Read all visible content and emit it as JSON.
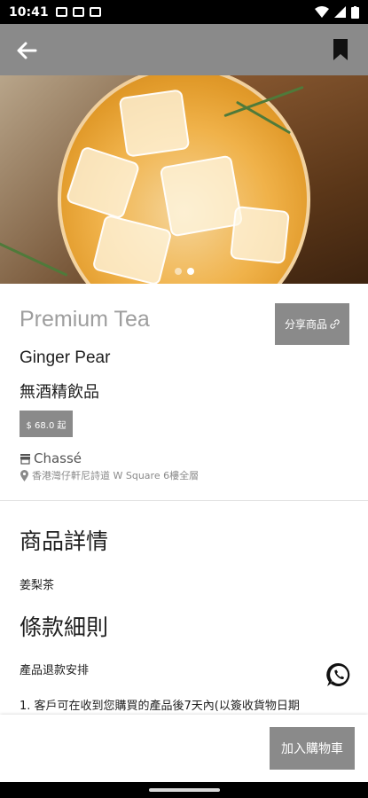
{
  "status_bar": {
    "time": "10:41"
  },
  "product": {
    "brand": "Premium Tea",
    "name": "Ginger Pear",
    "category": "無酒精飲品",
    "price": "$ 68.0 起",
    "shop_name": "Chassé",
    "address": "香港灣仔軒尼詩道 W Square 6樓全層",
    "share_label": "分享商品"
  },
  "details": {
    "title": "商品詳情",
    "text": "姜梨茶"
  },
  "terms": {
    "title": "條款細則",
    "subtitle": "產品退款安排",
    "item1": "1. 客戶可在收到您購買的產品後7天內(以簽收貨物日期"
  },
  "cart": {
    "label": "加入購物車"
  },
  "carousel": {
    "count": 2,
    "active": 1
  },
  "icons": [
    "back-arrow-icon",
    "bookmark-icon",
    "store-icon",
    "location-pin-icon",
    "link-icon",
    "whatsapp-icon"
  ],
  "colors": {
    "accent": "#8a8a8a",
    "text": "#1f1f1f",
    "muted": "#9e9e9e"
  }
}
